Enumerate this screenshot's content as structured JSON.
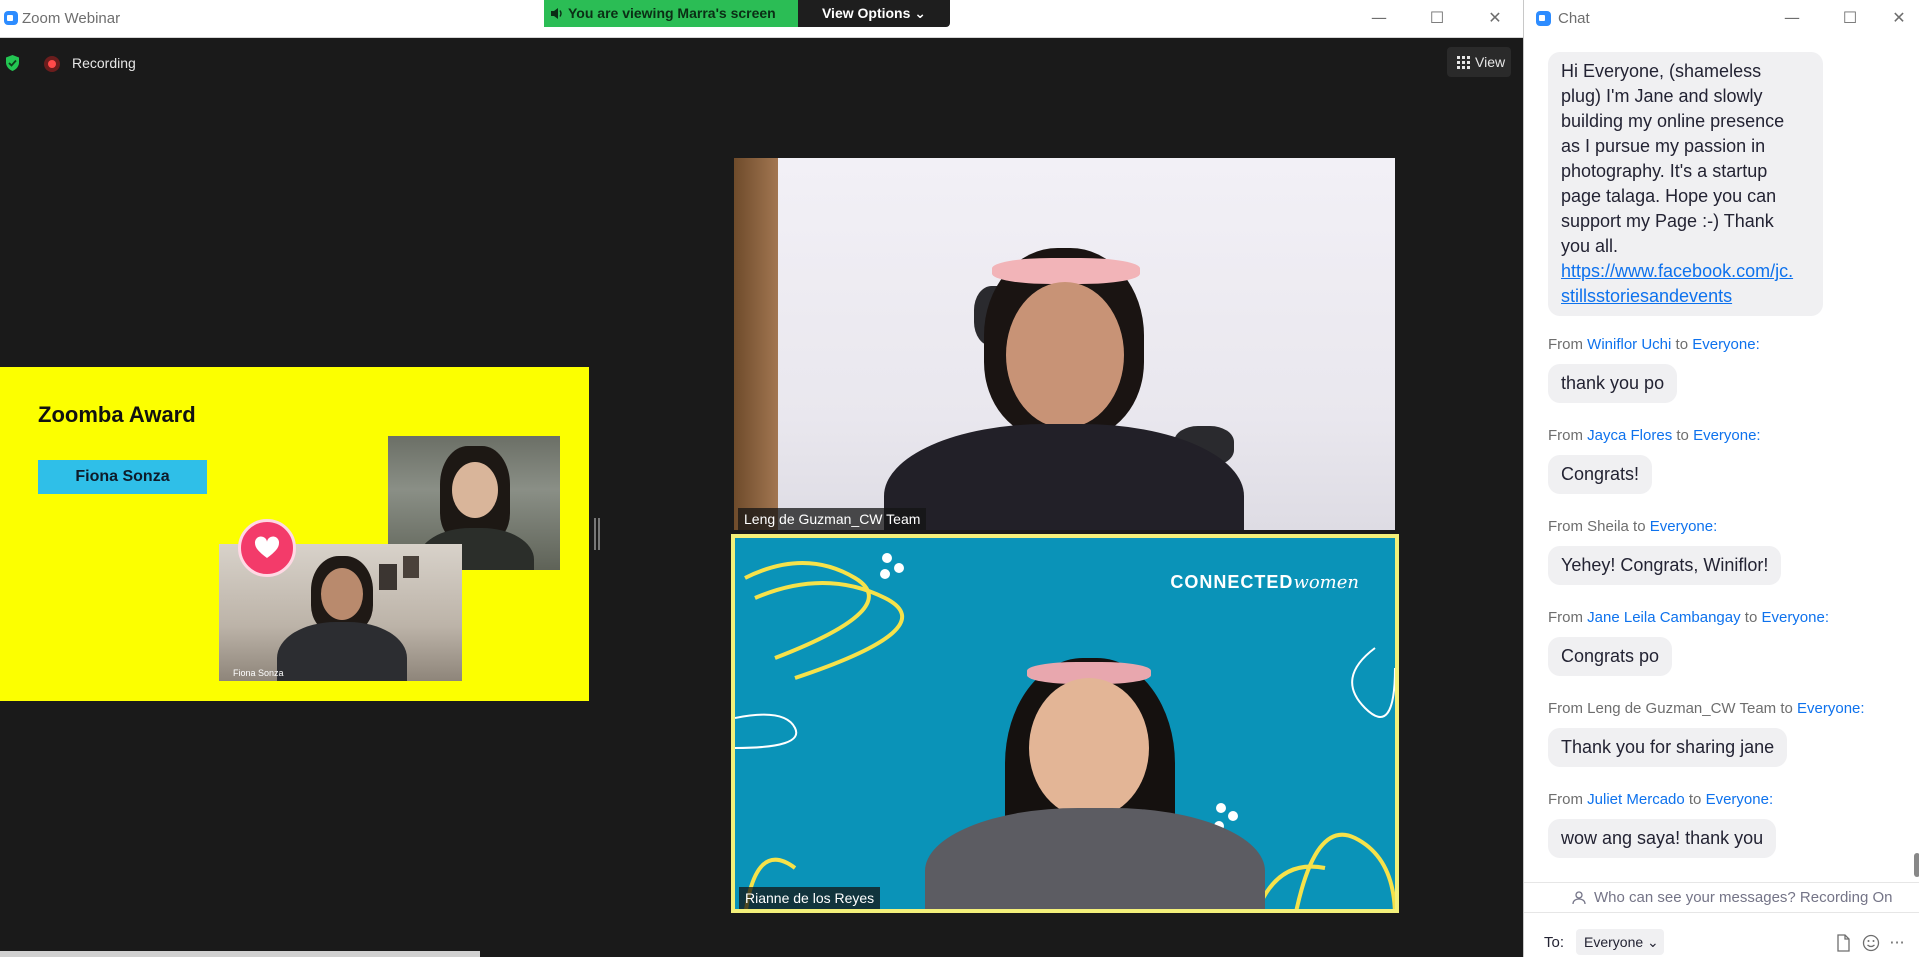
{
  "app": {
    "title": "Zoom Webinar",
    "window_controls": {
      "minimize": "—",
      "maximize": "☐",
      "close": "✕"
    }
  },
  "banner": {
    "viewing_text": "You are viewing Marra's screen",
    "view_options_label": "View Options ⌄"
  },
  "topbar": {
    "recording_label": "Recording",
    "view_label": "View"
  },
  "shared_slide": {
    "title": "Zoomba Award",
    "name_tag": "Fiona Sonza",
    "photo_label": "Fiona Sonza"
  },
  "videos": [
    {
      "name": "Leng de Guzman_CW Team"
    },
    {
      "name": "Rianne de los Reyes",
      "logo_bold": "CONNECTED",
      "logo_light": "women"
    }
  ],
  "chat": {
    "title": "Chat",
    "from_word": "From",
    "to_word": "to",
    "messages": [
      {
        "sender": "",
        "recipient": "",
        "lines": [
          "Hi Everyone, (shameless",
          "plug) I'm Jane and slowly",
          "building my online presence",
          "as I pursue my passion in",
          "photography. It's a startup",
          "page talaga. Hope you can",
          "support my Page :-) Thank",
          "you all."
        ],
        "link_lines": [
          "https://www.facebook.com/jc.",
          "stillsstoriesandevents"
        ]
      },
      {
        "sender": "Winiflor Uchi",
        "recipient": "Everyone:",
        "text": "thank you po"
      },
      {
        "sender": "Jayca Flores",
        "recipient": "Everyone:",
        "text": "Congrats!"
      },
      {
        "sender": "Sheila",
        "recipient": "Everyone:",
        "text": "Yehey! Congrats, Winiflor!"
      },
      {
        "sender": "Jane Leila Cambangay",
        "recipient": "Everyone:",
        "text": "Congrats po"
      },
      {
        "sender": "Leng de Guzman_CW Team",
        "recipient": "Everyone:",
        "text": "Thank you for sharing jane"
      },
      {
        "sender": "Juliet Mercado",
        "recipient": "Everyone:",
        "text": "wow ang saya! thank you"
      }
    ],
    "visibility_notice": "Who can see your messages? Recording On",
    "to_label": "To:",
    "to_value": "Everyone ⌄",
    "more_icon": "···"
  },
  "colors": {
    "accent": "#0e72ed",
    "recording": "#ff4a4a",
    "banner_green": "#2bbd55",
    "slide_yellow": "#fcff00"
  }
}
